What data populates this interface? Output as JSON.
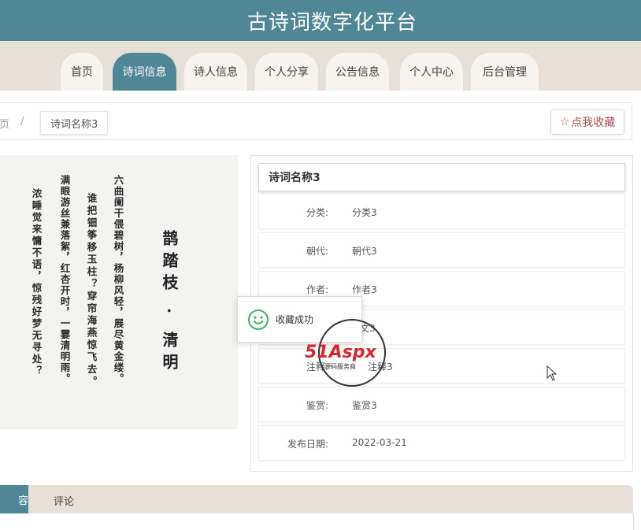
{
  "site": {
    "title": "古诗词数字化平台"
  },
  "nav": {
    "items": [
      {
        "label": "首页"
      },
      {
        "label": "诗词信息"
      },
      {
        "label": "诗人信息"
      },
      {
        "label": "个人分享"
      },
      {
        "label": "公告信息"
      },
      {
        "label": "个人中心"
      },
      {
        "label": "后台管理"
      }
    ],
    "active_index": 1
  },
  "breadcrumb": {
    "previous": "页",
    "separator": "/",
    "current": "诗词名称3"
  },
  "favorite_button": {
    "icon": "☆",
    "label": "点我收藏"
  },
  "poem_image": {
    "title_text": "鹊踏枝 · 清明",
    "columns": [
      "六曲阑干偎碧树，杨柳风轻，展尽黄金缕。",
      "谁把钿筝移玉柱？穿帘海燕惊飞去。",
      "满眼游丝兼落絮，红杏开时，一霎清明雨。",
      "浓睡觉来慵不语，惊残好梦无寻处？"
    ]
  },
  "detail": {
    "title": "诗词名称3",
    "rows": [
      {
        "label": "分类:",
        "value": "分类3"
      },
      {
        "label": "朝代:",
        "value": "朝代3"
      },
      {
        "label": "作者:",
        "value": "作者3"
      },
      {
        "label": "",
        "value": "文3"
      },
      {
        "label": "注释:",
        "value": "注释3"
      },
      {
        "label": "鉴赏:",
        "value": "鉴赏3"
      },
      {
        "label": "发布日期:",
        "value": "2022-03-21"
      }
    ]
  },
  "toast": {
    "text": "收藏成功"
  },
  "watermark": {
    "brand": "51Aspx",
    "sub": "源码服务商"
  },
  "bottom_tabs": [
    {
      "label": "容"
    },
    {
      "label": "评论"
    }
  ],
  "colors": {
    "primary": "#4f8797",
    "band": "#e8e0d6",
    "favorite": "#b54a4a",
    "toast_icon": "#3ab56a",
    "watermark_red": "#d9262c"
  }
}
